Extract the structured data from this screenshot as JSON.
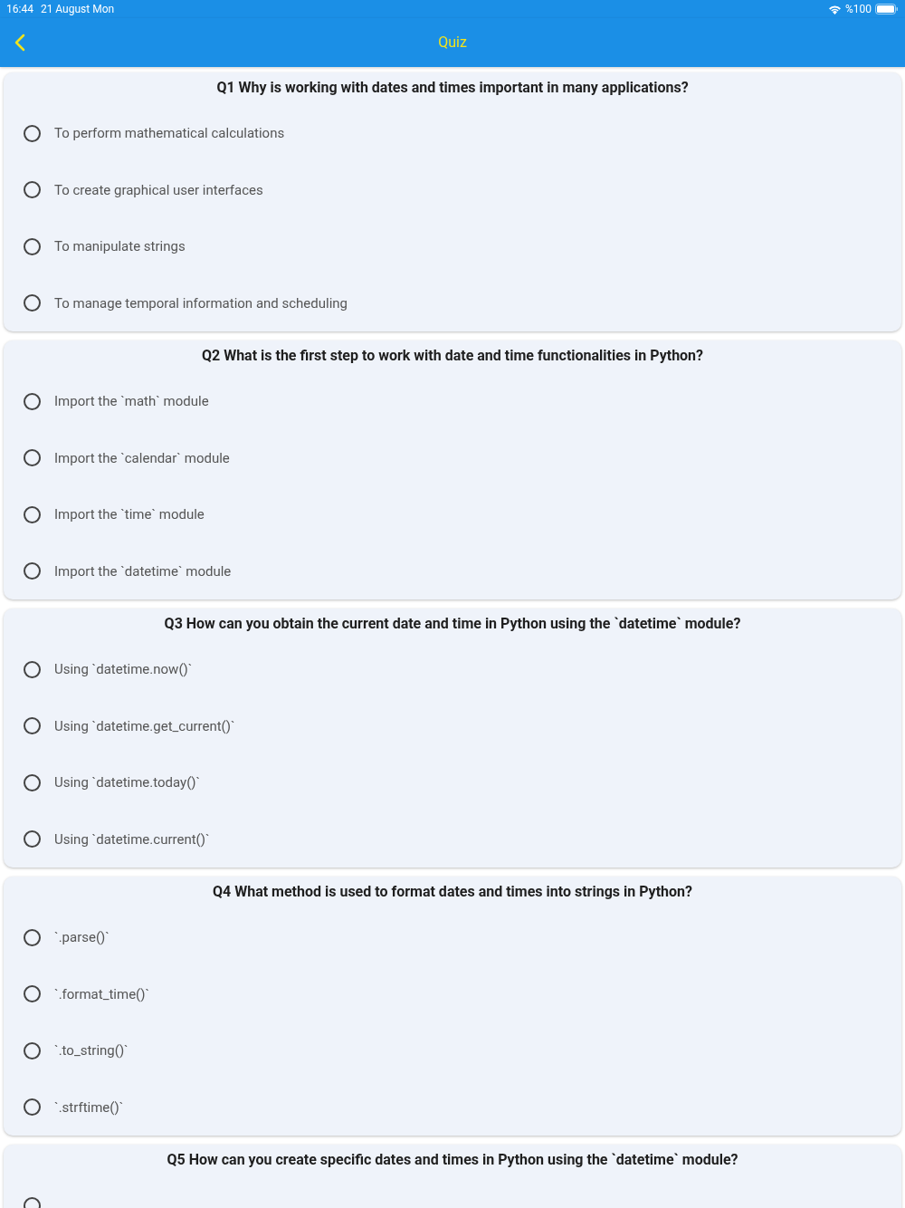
{
  "status_bar": {
    "time": "16:44",
    "date": "21 August Mon",
    "battery": "%100"
  },
  "nav_bar": {
    "title": "Quiz"
  },
  "questions": [
    {
      "title": "Q1 Why is working with dates and times important in many applications?",
      "options": [
        {
          "label": "To perform mathematical calculations",
          "selected": false
        },
        {
          "label": "To create graphical user interfaces",
          "selected": false
        },
        {
          "label": "To manipulate strings",
          "selected": false
        },
        {
          "label": "To manage temporal information and scheduling",
          "selected": false
        }
      ]
    },
    {
      "title": "Q2 What is the first step to work with date and time functionalities in Python?",
      "options": [
        {
          "label": "Import the `math` module",
          "selected": false
        },
        {
          "label": "Import the `calendar` module",
          "selected": false
        },
        {
          "label": "Import the `time` module",
          "selected": false
        },
        {
          "label": "Import the `datetime` module",
          "selected": false
        }
      ]
    },
    {
      "title": "Q3 How can you obtain the current date and time in Python using the `datetime` module?",
      "options": [
        {
          "label": "Using `datetime.now()`",
          "selected": false
        },
        {
          "label": "Using `datetime.get_current()`",
          "selected": false
        },
        {
          "label": "Using `datetime.today()`",
          "selected": false
        },
        {
          "label": "Using `datetime.current()`",
          "selected": false
        }
      ]
    },
    {
      "title": "Q4 What method is used to format dates and times into strings in Python?",
      "options": [
        {
          "label": "`.parse()`",
          "selected": false
        },
        {
          "label": "`.format_time()`",
          "selected": false
        },
        {
          "label": "`.to_string()`",
          "selected": false
        },
        {
          "label": "`.strftime()`",
          "selected": false
        }
      ]
    },
    {
      "title": "Q5 How can you create specific dates and times in Python using the `datetime` module?",
      "options": [
        {
          "selected": false
        }
      ]
    }
  ]
}
